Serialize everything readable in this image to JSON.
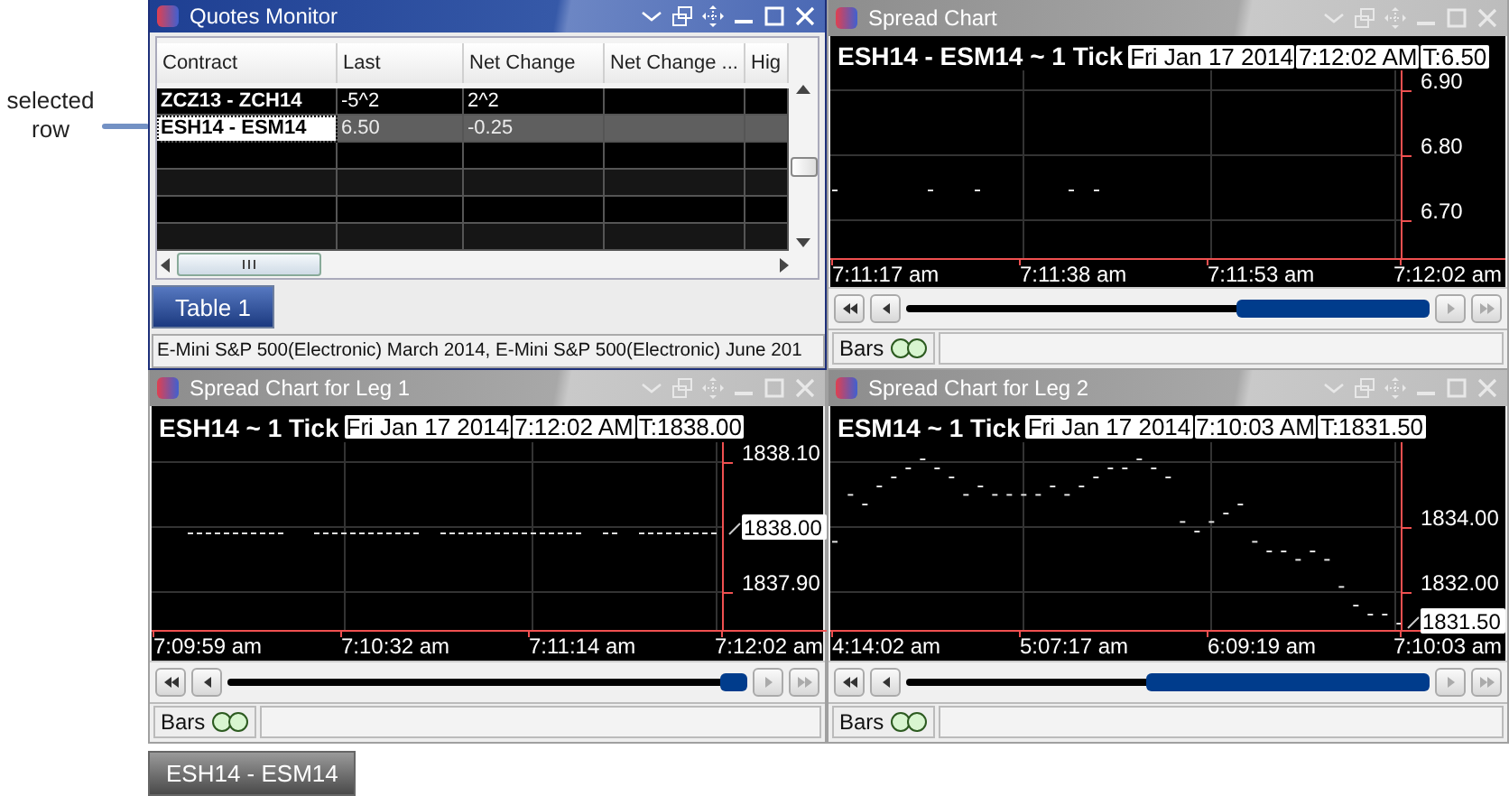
{
  "annotation": {
    "text": "selected row"
  },
  "quotes_monitor": {
    "title": "Quotes Monitor",
    "active": true,
    "columns": [
      "Contract",
      "Last",
      "Net Change",
      "Net Change ...",
      "Hig"
    ],
    "rows": [
      {
        "cells": [
          "ZCZ13 - ZCH14",
          "-5^2",
          "2^2"
        ],
        "selected": false
      },
      {
        "cells": [
          "ESH14 - ESM14",
          "6.50",
          "-0.25"
        ],
        "selected": true
      }
    ],
    "tabs": [
      {
        "label": "Table 1",
        "selected": true
      }
    ],
    "status": "E-Mini S&P 500(Electronic) March 2014, E-Mini S&P 500(Electronic) June 201"
  },
  "charts": [
    {
      "title": "Spread Chart",
      "active": false,
      "heading": "ESH14 - ESM14 ~ 1 Tick",
      "date": "Fri Jan 17 2014",
      "time": "7:12:02 AM",
      "price": "T:6.50",
      "y_labels": [
        {
          "text": "6.90",
          "boxed": false
        },
        {
          "text": "6.80",
          "boxed": false
        },
        {
          "text": "6.70",
          "boxed": false
        }
      ],
      "x_labels": [
        "7:11:17 am",
        "7:11:38 am",
        "7:11:53 am",
        "7:12:02 am"
      ],
      "style_label": "Bars"
    },
    {
      "title": "Spread Chart for Leg 1",
      "active": false,
      "heading": "ESH14 ~ 1 Tick",
      "date": "Fri Jan 17 2014",
      "time": "7:12:02 AM",
      "price": "T:1838.00",
      "y_labels": [
        {
          "text": "1838.10",
          "boxed": false
        },
        {
          "text": "1838.00",
          "boxed": true
        },
        {
          "text": "1837.90",
          "boxed": false
        }
      ],
      "x_labels": [
        "7:09:59 am",
        "7:10:32 am",
        "7:11:14 am",
        "7:12:02 am"
      ],
      "style_label": "Bars"
    },
    {
      "title": "Spread Chart for Leg 2",
      "active": false,
      "heading": "ESM14 ~ 1 Tick",
      "date": "Fri Jan 17 2014",
      "time": "7:10:03 AM",
      "price": "T:1831.50",
      "y_labels": [
        {
          "text": "1834.00",
          "boxed": false
        },
        {
          "text": "1832.00",
          "boxed": false
        },
        {
          "text": "1831.50",
          "boxed": true
        }
      ],
      "x_labels": [
        "4:14:02 am",
        "5:07:17 am",
        "6:09:19 am",
        "7:10:03 am"
      ],
      "style_label": "Bars"
    }
  ],
  "taskbar": [
    {
      "label": "ESH14 - ESM14"
    }
  ]
}
